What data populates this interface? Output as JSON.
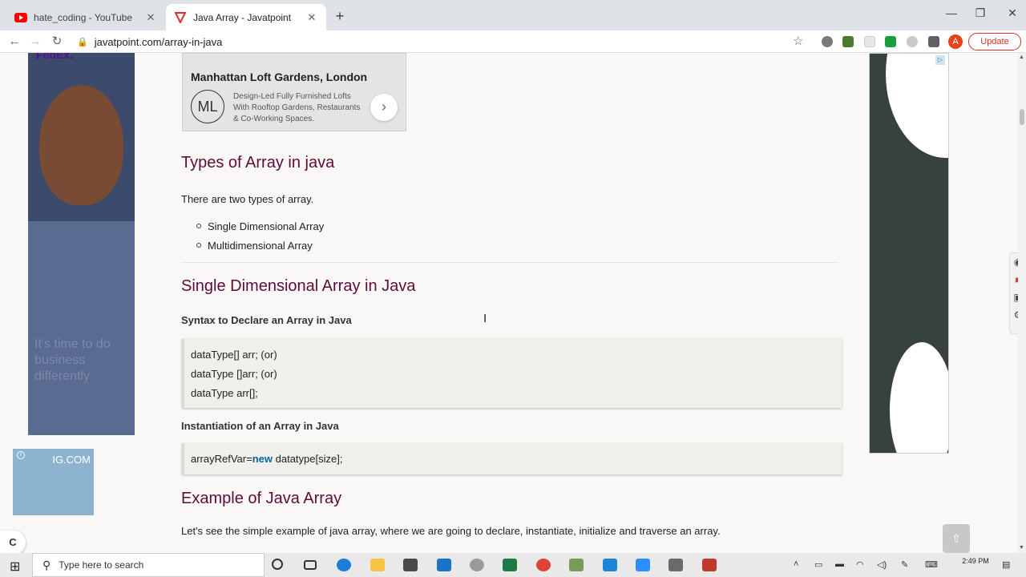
{
  "browser": {
    "tabs": [
      {
        "title": "hate_coding - YouTube",
        "favicon": "youtube-icon",
        "active": false
      },
      {
        "title": "Java Array - Javatpoint",
        "favicon": "javatpoint-icon",
        "active": true
      }
    ],
    "url": "javatpoint.com/array-in-java",
    "update_label": "Update",
    "avatar_letter": "A"
  },
  "ads": {
    "left_brand": "FedEx.",
    "left_slogan": "It's time to do business differently",
    "ig_brand": "IG.COM",
    "ig_info": "i",
    "top_title": "Manhattan Loft Gardens, London",
    "top_desc": "Design-Led Fully Furnished Lofts With Rooftop Gardens, Restaurants & Co-Working Spaces.",
    "top_mono": "ML",
    "top_next": "›",
    "right_info": "▷"
  },
  "content": {
    "types_heading": "Types of Array in java",
    "types_intro": "There are two types of array.",
    "types_list": [
      "Single Dimensional Array",
      "Multidimensional Array"
    ],
    "single_heading": "Single Dimensional Array in Java",
    "syntax_label": "Syntax to Declare an Array in Java",
    "syntax_lines": [
      "dataType[] arr; (or)",
      "dataType []arr; (or)",
      "dataType arr[];"
    ],
    "inst_label": "Instantiation of an Array in Java",
    "inst_pre": "arrayRefVar=",
    "inst_kw": "new",
    "inst_post": " datatype[size];",
    "example_heading": "Example of Java Array",
    "example_intro": "Let's see the simple example of java array, where we are going to declare, instantiate, initialize and traverse an array."
  },
  "widgets": {
    "c_button": "C",
    "back_to_top": "⇧"
  },
  "taskbar": {
    "search_placeholder": "Type here to search",
    "time": "2:49 PM"
  }
}
